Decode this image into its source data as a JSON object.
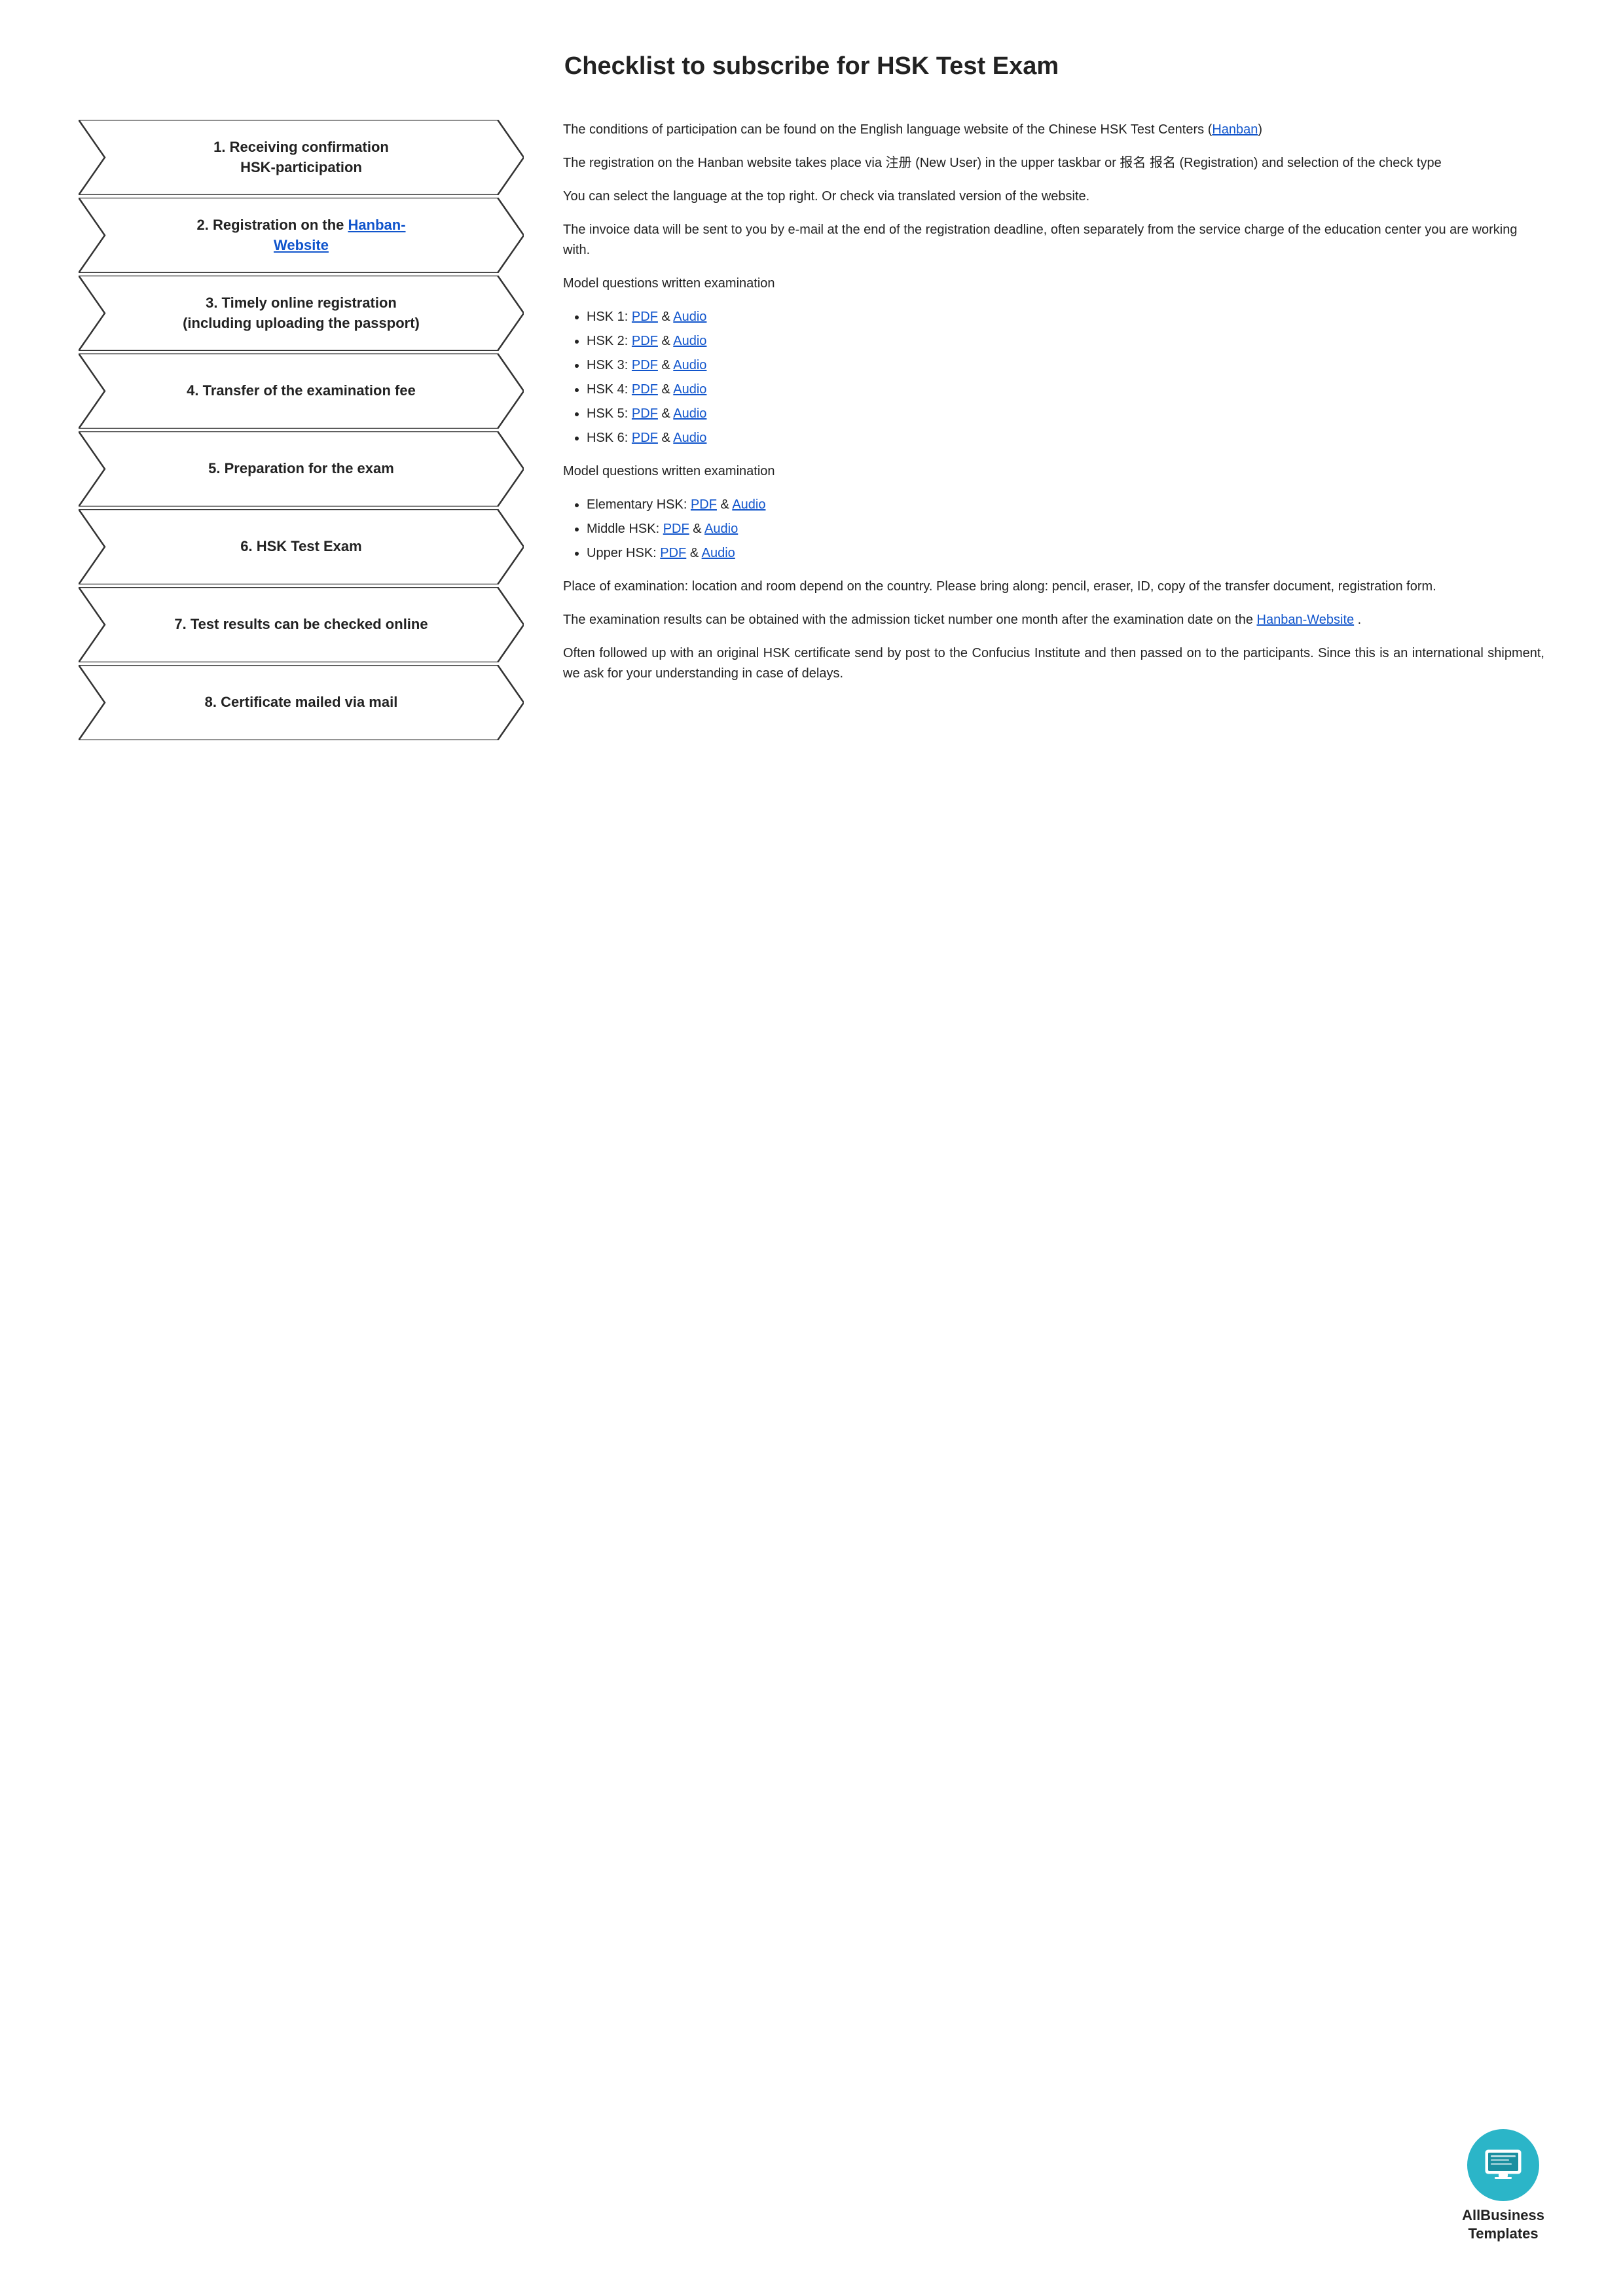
{
  "title": "Checklist to subscribe for HSK Test Exam",
  "steps": [
    {
      "id": 1,
      "label": "1. Receiving confirmation\nHSK-participation",
      "hasLink": false
    },
    {
      "id": 2,
      "label_before": "2. Registration on the ",
      "link_text": "Hanban-\nWebsite",
      "link_href": "#",
      "label_after": "",
      "hasLink": true
    },
    {
      "id": 3,
      "label": "3. Timely online registration\n(including uploading the passport)",
      "hasLink": false
    },
    {
      "id": 4,
      "label": "4. Transfer of the examination fee",
      "hasLink": false
    },
    {
      "id": 5,
      "label": "5. Preparation for the exam",
      "hasLink": false
    },
    {
      "id": 6,
      "label": "6. HSK Test Exam",
      "hasLink": false
    },
    {
      "id": 7,
      "label": "7. Test results can be checked online",
      "hasLink": false
    },
    {
      "id": 8,
      "label": "8. Certificate mailed via mail",
      "hasLink": false
    }
  ],
  "desc": {
    "para1": "The conditions of participation can be found on the English language website of the Chinese HSK Test Centers  (",
    "para1_link_text": "Hanban",
    "para1_link_href": "#",
    "para1_end": ")",
    "para2": "The registration on the Hanban website takes place via 注册 (New User) in the upper taskbar or 报名 报名 (Registration) and selection of the check type",
    "para3": "You can select the language at the top right. Or check via translated version of the website.",
    "para4": "The invoice data will be sent to you by e-mail at the end of the registration deadline, often separately from the service charge of the education center you are working with.",
    "section1_title": "Model questions written examination",
    "hsk_list": [
      {
        "label": "HSK 1: ",
        "pdf_text": "PDF",
        "pdf_href": "#",
        "amp": " & ",
        "audio_text": "Audio",
        "audio_href": "#"
      },
      {
        "label": "HSK 2: ",
        "pdf_text": "PDF",
        "pdf_href": "#",
        "amp": " & ",
        "audio_text": "Audio",
        "audio_href": "#"
      },
      {
        "label": "HSK 3: ",
        "pdf_text": "PDF",
        "pdf_href": "#",
        "amp": " & ",
        "audio_text": "Audio",
        "audio_href": "#"
      },
      {
        "label": "HSK 4: ",
        "pdf_text": "PDF",
        "pdf_href": "#",
        "amp": " & ",
        "audio_text": "Audio",
        "audio_href": "#"
      },
      {
        "label": "HSK 5: ",
        "pdf_text": "PDF",
        "pdf_href": "#",
        "amp": " & ",
        "audio_text": "Audio",
        "audio_href": "#"
      },
      {
        "label": "HSK 6: ",
        "pdf_text": "PDF",
        "pdf_href": "#",
        "amp": " & ",
        "audio_text": "Audio",
        "audio_href": "#"
      }
    ],
    "section2_title": "Model questions written examination",
    "hsk_list2": [
      {
        "label": "Elementary HSK: ",
        "pdf_text": "PDF",
        "pdf_href": "#",
        "amp": " & ",
        "audio_text": "Audio",
        "audio_href": "#"
      },
      {
        "label": "Middle HSK: ",
        "pdf_text": "PDF",
        "pdf_href": "#",
        "amp": " & ",
        "audio_text": "Audio",
        "audio_href": "#"
      },
      {
        "label": "Upper HSK: ",
        "pdf_text": "PDF",
        "pdf_href": "#",
        "amp": " & ",
        "audio_text": "Audio",
        "audio_href": "#"
      }
    ],
    "para5": "Place of examination: location and room depend on the country. Please bring along: pencil, eraser, ID, copy of the transfer document, registration form.",
    "para6_before": "The examination results can be obtained with the admission ticket number one month after the examination date on the ",
    "para6_link_text": "Hanban-Website",
    "para6_link_href": "#",
    "para6_end": " .",
    "para7": "Often followed up with an original HSK certificate send by post to the Confucius Institute and then passed on to the participants. Since this is an international shipment, we ask for your understanding in case of delays."
  },
  "logo": {
    "brand_line1": "AllBusiness",
    "brand_line2": "Templates"
  }
}
